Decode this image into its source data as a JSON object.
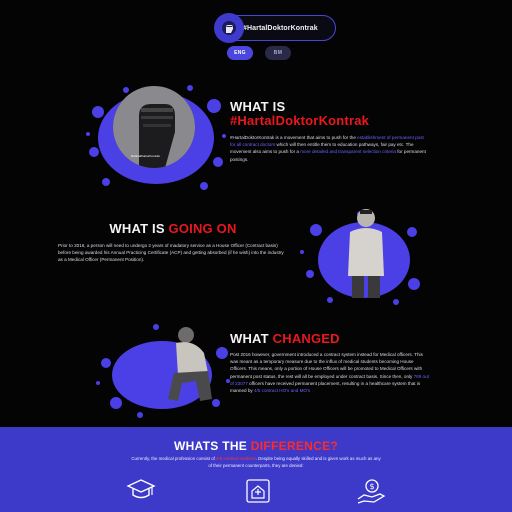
{
  "header": {
    "logo_text": "#HartalDoktorKontrak",
    "languages": [
      {
        "label": "ENG",
        "active": true
      },
      {
        "label": "BM",
        "active": false
      }
    ]
  },
  "section_what_is": {
    "heading_line1": "WHAT IS",
    "heading_line2": "#HartalDoktorKontrak",
    "body": [
      {
        "t": "#HartalDoktorKontrak is a movement that aims to push for the ",
        "hl": false
      },
      {
        "t": "establishment of permanent post for all contract doctors",
        "hl": true
      },
      {
        "t": " which will then entitle them to education pathways, fair pay etc. The movement also aims to push for a ",
        "hl": false
      },
      {
        "t": "more detailed and transparent selection criteria",
        "hl": true
      },
      {
        "t": " for permanent postings.",
        "hl": false
      }
    ],
    "image_caption": "#HartalDoktorKontrak"
  },
  "section_going_on": {
    "heading_plain": "WHAT IS ",
    "heading_red": "GOING ON",
    "body": "Prior to 2016, a person will need to undergo 2 years of madatory service as a House Officer (Contract basis) before being awarded his Annual Practicing Certificate (ACP) and getting absorbed (if he wish) into the industry as a Medical Officer (Permanent Position)."
  },
  "section_changed": {
    "heading_plain": "WHAT ",
    "heading_red": "CHANGED",
    "body": [
      {
        "t": "Post 2016 however, government introduced a contract system instead for Medical officers. This was meant as a temporary measure due to the influx of medical students becoming House Officers. This means, only a portion of House Officers will be promoted to Medical Officers with permanent post status, the rest will all be employed under contract basis. Since then, only ",
        "hl": false
      },
      {
        "t": "789 out of 23077",
        "hl": true
      },
      {
        "t": " officers have received permanent placement, resulting in a healthcare system that is manned by ",
        "hl": false
      },
      {
        "t": "4/5 contract HO's and MO's",
        "hl": true
      }
    ]
  },
  "footer": {
    "title_plain": "WHATS THE ",
    "title_red": "DIFFERENCE?",
    "sub_before": "Currently, the medical profession consist of ",
    "sub_highlight": "4/5 contract workers",
    "sub_after": ". Despite being equally skilled and is given work as much as any of their permanent counterparts, they are denied:",
    "icons": [
      {
        "name": "graduation-cap-icon"
      },
      {
        "name": "hospital-document-icon"
      },
      {
        "name": "money-hand-icon"
      }
    ]
  },
  "colors": {
    "accent": "#4b46de",
    "splatter": "#4b3fe6",
    "red": "#e8181e",
    "background": "#040405"
  }
}
